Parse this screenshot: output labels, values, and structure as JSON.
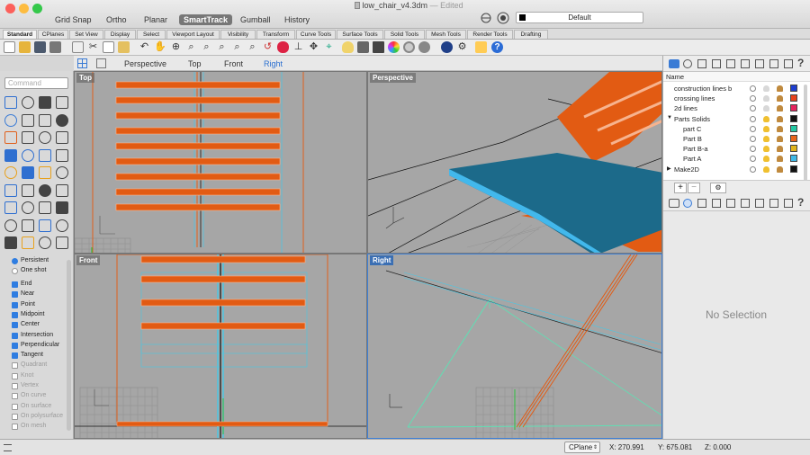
{
  "window": {
    "file_name": "low_chair_v4.3dm",
    "edited": "— Edited",
    "traffic": [
      "#fc605b",
      "#fdbc40",
      "#34c84a"
    ]
  },
  "modes": [
    "Grid Snap",
    "Ortho",
    "Planar",
    "SmartTrack",
    "Gumball",
    "History"
  ],
  "active_mode": "SmartTrack",
  "current_layer": "Default",
  "tabs": [
    "Standard",
    "CPlanes",
    "Set View",
    "Display",
    "Select",
    "Viewport Layout",
    "Visibility",
    "Transform",
    "Curve Tools",
    "Surface Tools",
    "Solid Tools",
    "Mesh Tools",
    "Render Tools",
    "Drafting"
  ],
  "active_tab": "Standard",
  "viewport_tabs": [
    "Perspective",
    "Top",
    "Front",
    "Right"
  ],
  "active_viewport_tab": "Right",
  "command_placeholder": "Command",
  "viewports": {
    "top": "Top",
    "perspective": "Perspective",
    "front": "Front",
    "right": "Right"
  },
  "osnap": {
    "persistent": "Persistent",
    "one_shot": "One shot",
    "items": [
      {
        "label": "End",
        "checked": true
      },
      {
        "label": "Near",
        "checked": true
      },
      {
        "label": "Point",
        "checked": true
      },
      {
        "label": "Midpoint",
        "checked": true
      },
      {
        "label": "Center",
        "checked": true
      },
      {
        "label": "Intersection",
        "checked": true
      },
      {
        "label": "Perpendicular",
        "checked": true
      },
      {
        "label": "Tangent",
        "checked": true
      },
      {
        "label": "Quadrant",
        "checked": false
      },
      {
        "label": "Knot",
        "checked": false
      },
      {
        "label": "Vertex",
        "checked": false
      },
      {
        "label": "On curve",
        "checked": false
      },
      {
        "label": "On surface",
        "checked": false
      },
      {
        "label": "On polysurface",
        "checked": false
      },
      {
        "label": "On mesh",
        "checked": false
      }
    ]
  },
  "layers": {
    "header": "Name",
    "rows": [
      {
        "name": "construction lines b",
        "level": 0,
        "color": "#1f3fd1",
        "expand": ""
      },
      {
        "name": "crossing lines",
        "level": 0,
        "color": "#e8421c",
        "expand": ""
      },
      {
        "name": "2d lines",
        "level": 0,
        "color": "#e6245e",
        "expand": ""
      },
      {
        "name": "Parts Solids",
        "level": 0,
        "color": "#111111",
        "expand": "▼"
      },
      {
        "name": "part C",
        "level": 1,
        "color": "#23c9a4",
        "expand": ""
      },
      {
        "name": "Part B",
        "level": 1,
        "color": "#e8651b",
        "expand": ""
      },
      {
        "name": "Part B-a",
        "level": 1,
        "color": "#e0b41c",
        "expand": ""
      },
      {
        "name": "Part A",
        "level": 1,
        "color": "#3fb9e6",
        "expand": ""
      },
      {
        "name": "Make2D",
        "level": 0,
        "color": "#111111",
        "expand": "▶"
      }
    ]
  },
  "properties": {
    "empty_text": "No Selection"
  },
  "status": {
    "cplane": "CPlane",
    "x": "X: 270.991",
    "y": "Y: 675.081",
    "z": "Z: 0.000"
  }
}
